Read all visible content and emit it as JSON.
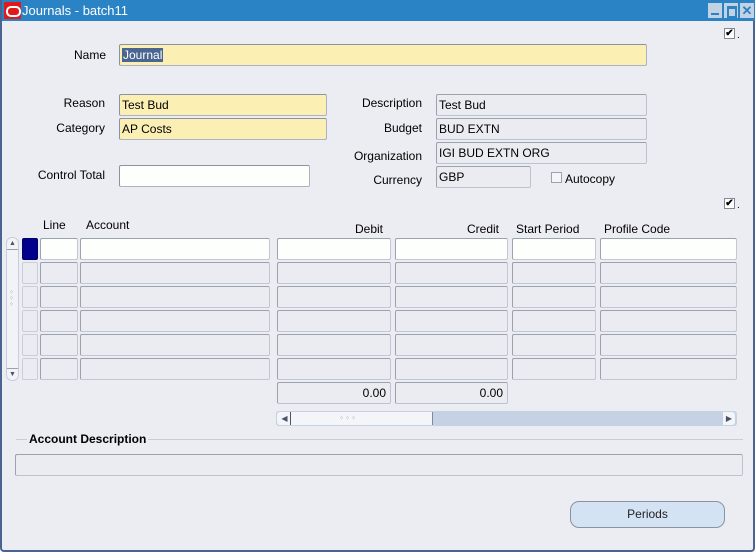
{
  "window": {
    "title": "Journals - batch11",
    "controls": [
      "minimize",
      "maximize",
      "close"
    ]
  },
  "header_fields": {
    "name": {
      "label": "Name",
      "value": "Journal",
      "selected": true
    },
    "reason": {
      "label": "Reason",
      "value": "Test Bud"
    },
    "category": {
      "label": "Category",
      "value": "AP Costs"
    },
    "control_total": {
      "label": "Control Total",
      "value": ""
    },
    "description": {
      "label": "Description",
      "value": "Test Bud"
    },
    "budget": {
      "label": "Budget",
      "value": "BUD EXTN"
    },
    "organization": {
      "label": "Organization",
      "value": "IGI BUD EXTN ORG"
    },
    "currency": {
      "label": "Currency",
      "value": "GBP"
    },
    "autocopy": {
      "label": "Autocopy",
      "checked": false
    }
  },
  "top_checkbox": {
    "checked": true,
    "mark": "✔",
    "dot": "."
  },
  "lines_checkbox": {
    "checked": true,
    "mark": "✔",
    "dot": "."
  },
  "lines_table": {
    "columns": [
      "Line",
      "Account",
      "Debit",
      "Credit",
      "Start Period",
      "Profile Code"
    ],
    "rows": [
      {
        "line": "",
        "account": "",
        "debit": "",
        "credit": "",
        "start_period": "",
        "profile_code": "",
        "current": true
      },
      {
        "line": "",
        "account": "",
        "debit": "",
        "credit": "",
        "start_period": "",
        "profile_code": ""
      },
      {
        "line": "",
        "account": "",
        "debit": "",
        "credit": "",
        "start_period": "",
        "profile_code": ""
      },
      {
        "line": "",
        "account": "",
        "debit": "",
        "credit": "",
        "start_period": "",
        "profile_code": ""
      },
      {
        "line": "",
        "account": "",
        "debit": "",
        "credit": "",
        "start_period": "",
        "profile_code": ""
      },
      {
        "line": "",
        "account": "",
        "debit": "",
        "credit": "",
        "start_period": "",
        "profile_code": ""
      }
    ],
    "totals": {
      "debit": "0.00",
      "credit": "0.00"
    }
  },
  "account_description": {
    "title": "Account Description",
    "value": ""
  },
  "buttons": {
    "periods": "Periods"
  },
  "icons": {
    "scroll_up": "▲",
    "scroll_down": "▼",
    "scroll_left": "◀",
    "scroll_right": "▶",
    "grip": "⁘"
  }
}
